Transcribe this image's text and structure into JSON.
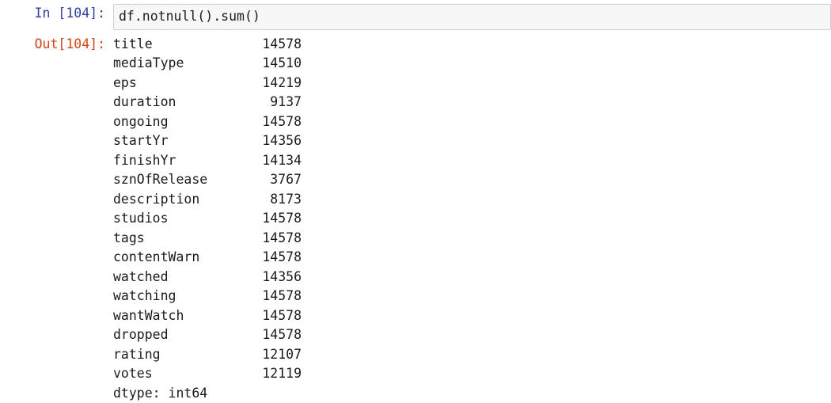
{
  "notebook": {
    "cell": {
      "execution_count": "104",
      "input_prompt": "In [104]:",
      "output_prompt": "Out[104]:",
      "code": "df.notnull().sum()"
    },
    "colors": {
      "in_prompt": "#303F9F",
      "out_prompt": "#D84315",
      "code_background": "#f7f7f7",
      "code_border": "#cfcfcf",
      "text": "#1a1a1a",
      "page_background": "#ffffff"
    },
    "output": {
      "rows": [
        {
          "label": "title",
          "value": "14578"
        },
        {
          "label": "mediaType",
          "value": "14510"
        },
        {
          "label": "eps",
          "value": "14219"
        },
        {
          "label": "duration",
          "value": "9137"
        },
        {
          "label": "ongoing",
          "value": "14578"
        },
        {
          "label": "startYr",
          "value": "14356"
        },
        {
          "label": "finishYr",
          "value": "14134"
        },
        {
          "label": "sznOfRelease",
          "value": "3767"
        },
        {
          "label": "description",
          "value": "8173"
        },
        {
          "label": "studios",
          "value": "14578"
        },
        {
          "label": "tags",
          "value": "14578"
        },
        {
          "label": "contentWarn",
          "value": "14578"
        },
        {
          "label": "watched",
          "value": "14356"
        },
        {
          "label": "watching",
          "value": "14578"
        },
        {
          "label": "wantWatch",
          "value": "14578"
        },
        {
          "label": "dropped",
          "value": "14578"
        },
        {
          "label": "rating",
          "value": "12107"
        },
        {
          "label": "votes",
          "value": "12119"
        }
      ],
      "dtype_line": "dtype: int64"
    }
  }
}
